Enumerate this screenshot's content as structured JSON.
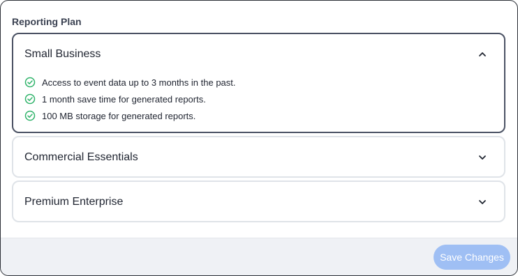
{
  "section_title": "Reporting Plan",
  "plans": [
    {
      "name": "Small Business",
      "expanded": true,
      "chevron_icon": "chevron-up-icon",
      "features": [
        "Access to event data up to 3 months in the past.",
        "1 month save time for generated reports.",
        "100 MB storage for generated reports."
      ]
    },
    {
      "name": "Commercial Essentials",
      "expanded": false,
      "chevron_icon": "chevron-down-icon"
    },
    {
      "name": "Premium Enterprise",
      "expanded": false,
      "chevron_icon": "chevron-down-icon"
    }
  ],
  "footer": {
    "save_label": "Save Changes"
  },
  "colors": {
    "check": "#2fb36a",
    "button_bg": "#9fbff4",
    "selected_border": "#4a5163"
  }
}
